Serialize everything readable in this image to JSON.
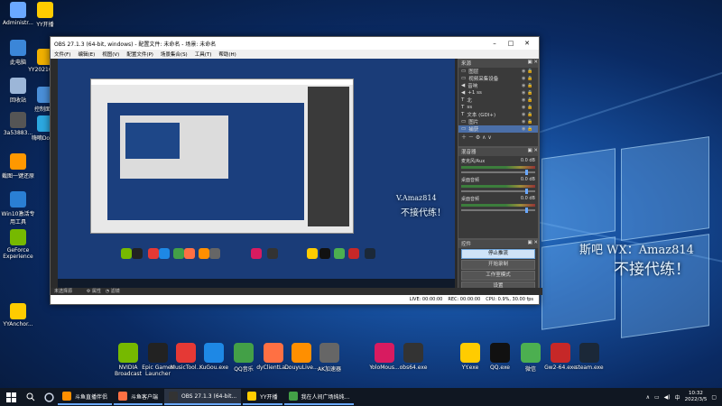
{
  "desktop": {
    "icons_left": [
      {
        "label": "Administr...",
        "color": "#6aa8ff"
      },
      {
        "label": "YY开播",
        "color": "#ffcc00"
      },
      {
        "label": "此电脑",
        "color": "#3b86d8"
      },
      {
        "label": "YY2021OO...",
        "color": "#f0b000"
      },
      {
        "label": "回收站",
        "color": "#9cb6d8"
      },
      {
        "label": "控制面板",
        "color": "#4a8fd8"
      },
      {
        "label": "3a53883...",
        "color": "#555"
      },
      {
        "label": "嗨嘀Dow...",
        "color": "#2ca8e0"
      },
      {
        "label": "截图一键还原",
        "color": "#ff9800"
      },
      {
        "label": "Win10激活专用工具",
        "color": "#2a7fd4"
      },
      {
        "label": "GeForce Experience",
        "color": "#76b900"
      },
      {
        "label": "YYAnchor...",
        "color": "#ffcc00"
      }
    ],
    "ad_line1": "斯吧 WX：Amaz814",
    "ad_line2": "不接代练！",
    "ad_small1": "V.Amaz814",
    "ad_small2": "不接代练！",
    "dock_icons": [
      {
        "label": "NVIDIA Broadcast",
        "color": "#76b900"
      },
      {
        "label": "Epic Games Launcher",
        "color": "#222"
      },
      {
        "label": "MusicTool...",
        "color": "#e53935"
      },
      {
        "label": "KuGou.exe",
        "color": "#1e88e5"
      },
      {
        "label": "QQ音乐",
        "color": "#43a047"
      },
      {
        "label": "dyClientLa...",
        "color": "#ff7043"
      },
      {
        "label": "DouyuLive...",
        "color": "#ff8f00"
      },
      {
        "label": "AK加速器",
        "color": "#666"
      },
      {
        "label": "YoloMous...",
        "color": "#d81b60"
      },
      {
        "label": "obs64.exe",
        "color": "#333"
      },
      {
        "label": "YY.exe",
        "color": "#ffcc00"
      },
      {
        "label": "QQ.exe",
        "color": "#111"
      },
      {
        "label": "微信",
        "color": "#4caf50"
      },
      {
        "label": "Gw2-64.exe",
        "color": "#c62828"
      },
      {
        "label": "steam.exe",
        "color": "#1b2838"
      }
    ]
  },
  "obs": {
    "title": "OBS 27.1.3 (64-bit, windows) - 配置文件: 未命名 - 场景: 未命名",
    "menu": [
      "文件(F)",
      "编辑(E)",
      "视图(V)",
      "配置文件(P)",
      "场景集合(S)",
      "工具(T)",
      "帮助(H)"
    ],
    "sources_header": "来源",
    "sources": [
      {
        "name": "图层",
        "icon": "▭"
      },
      {
        "name": "视频采集设备",
        "icon": "▭"
      },
      {
        "name": "音响",
        "icon": "◀"
      },
      {
        "name": "+1 ss",
        "icon": "◀"
      },
      {
        "name": "北",
        "icon": "T"
      },
      {
        "name": "ss",
        "icon": "T"
      },
      {
        "name": "文本 (GDI+)",
        "icon": "T"
      },
      {
        "name": "图片",
        "icon": "▭"
      },
      {
        "name": "捕获",
        "icon": "▭"
      }
    ],
    "mixer_header": "混音器",
    "mixer": [
      {
        "name": "麦克风/Aux",
        "db": "0.0 dB"
      },
      {
        "name": "桌面音频",
        "db": "0.0 dB"
      },
      {
        "name": "桌面音频",
        "db": "0.0 dB"
      }
    ],
    "controls_header": "控件",
    "controls": [
      "停止推流",
      "开始录制",
      "工作室模式",
      "设置",
      "退出"
    ],
    "scene_label": "未选择源",
    "scene_props": "属性",
    "scene_filters": "滤镜",
    "status": {
      "live": "LIVE: 00:00:00",
      "rec": "REC: 00:00:00",
      "cpu": "CPU: 0.9%, 30.00 fps"
    }
  },
  "taskbar": {
    "tasks": [
      {
        "label": "斗鱼直播伴侣",
        "color": "#ff8f00",
        "active": false
      },
      {
        "label": "斗鱼客户端",
        "color": "#ff7043",
        "active": false
      },
      {
        "label": "OBS 27.1.3 (64-bit...",
        "color": "#333",
        "active": true
      },
      {
        "label": "YY开播",
        "color": "#ffcc00",
        "active": false
      },
      {
        "label": "我在人间广场纯纯...",
        "color": "#43a047",
        "active": false
      }
    ],
    "time": "10:32",
    "date": "2022/3/5"
  }
}
